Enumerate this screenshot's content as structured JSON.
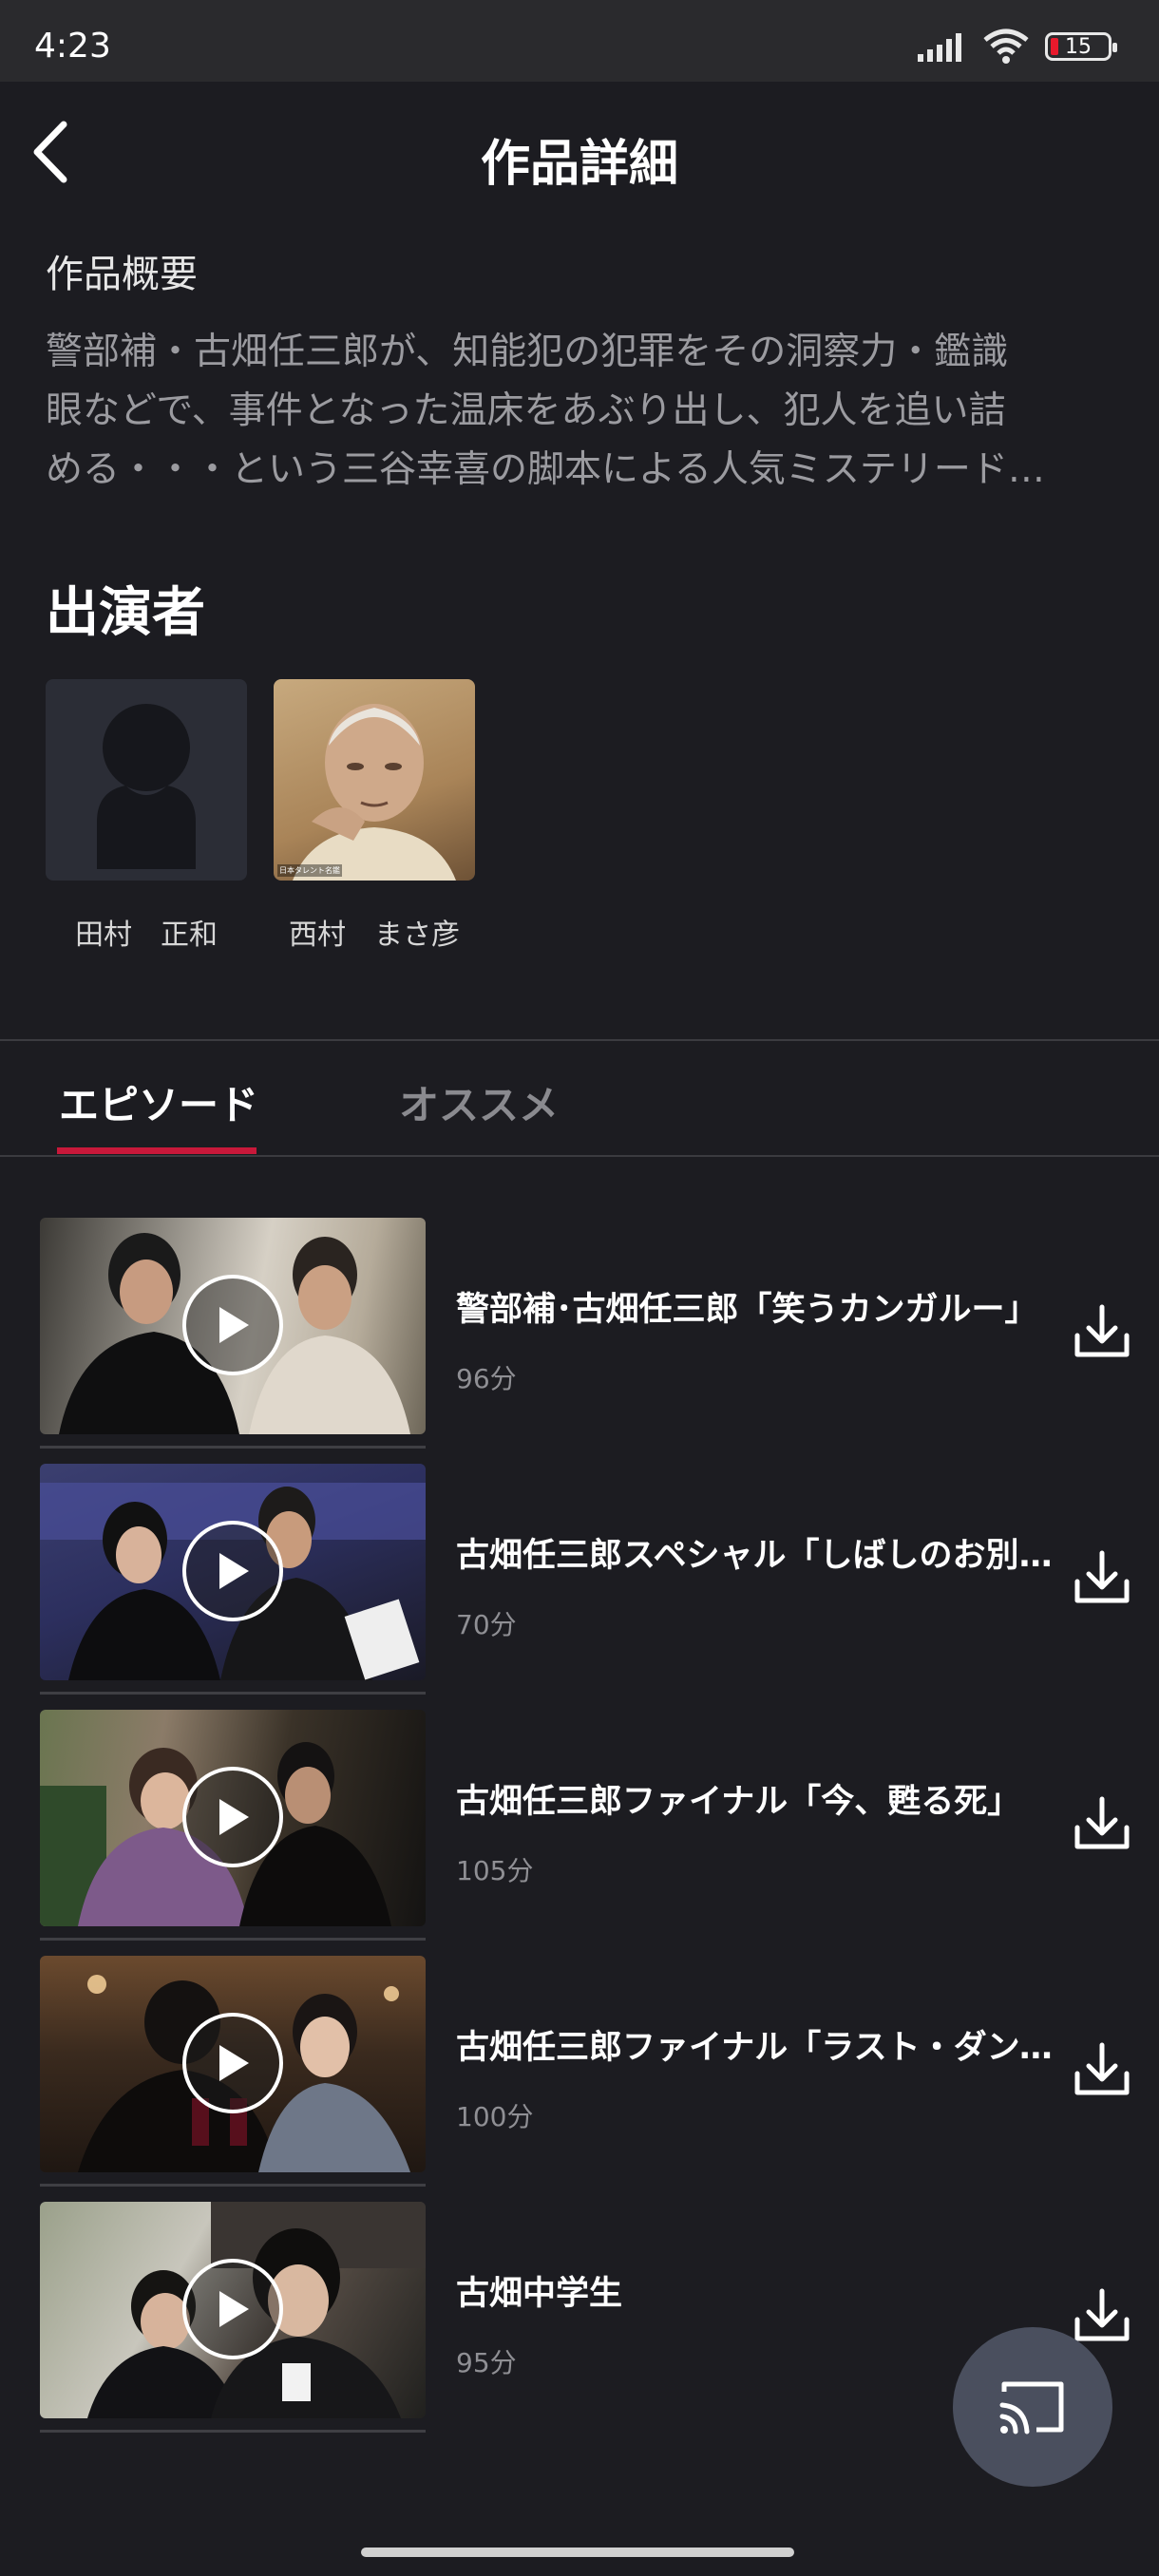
{
  "status_bar": {
    "time": "4:23",
    "battery": "15"
  },
  "header": {
    "title": "作品詳細"
  },
  "summary": {
    "heading": "作品概要",
    "lines": [
      "警部補・古畑任三郎が、知能犯の犯罪をその洞察力・鑑識",
      "眼などで、事件となった温床をあぶり出し、犯人を追い詰",
      "める・・・という三谷幸喜の脚本による人気ミステリード…"
    ]
  },
  "cast": {
    "heading": "出演者",
    "members": [
      {
        "name": "田村　正和",
        "has_photo": false
      },
      {
        "name": "西村　まさ彦",
        "has_photo": true,
        "photo_credit": "日本タレント名鑑"
      }
    ]
  },
  "tabs": [
    {
      "label": "エピソード",
      "active": true
    },
    {
      "label": "オススメ",
      "active": false
    }
  ],
  "episodes": [
    {
      "title": "警部補･古畑任三郎「笑うカンガルー」",
      "duration": "96分"
    },
    {
      "title": "古畑任三郎スペシャル「しばしのお別れ」",
      "duration": "70分"
    },
    {
      "title": "古畑任三郎ファイナル「今、甦る死」",
      "duration": "105分"
    },
    {
      "title": "古畑任三郎ファイナル「ラスト・ダンス」",
      "duration": "100分"
    },
    {
      "title": "古畑中学生",
      "duration": "95分"
    }
  ],
  "colors": {
    "background": "#1c1c21",
    "accent": "#c8183a",
    "fab": "#4a4f5e",
    "muted_text": "#9b9ba0"
  },
  "icons": {
    "back": "chevron-left-icon",
    "download": "download-icon",
    "play": "play-icon",
    "cast": "cast-icon",
    "wifi": "wifi-icon",
    "signal": "signal-icon",
    "battery": "battery-icon"
  }
}
